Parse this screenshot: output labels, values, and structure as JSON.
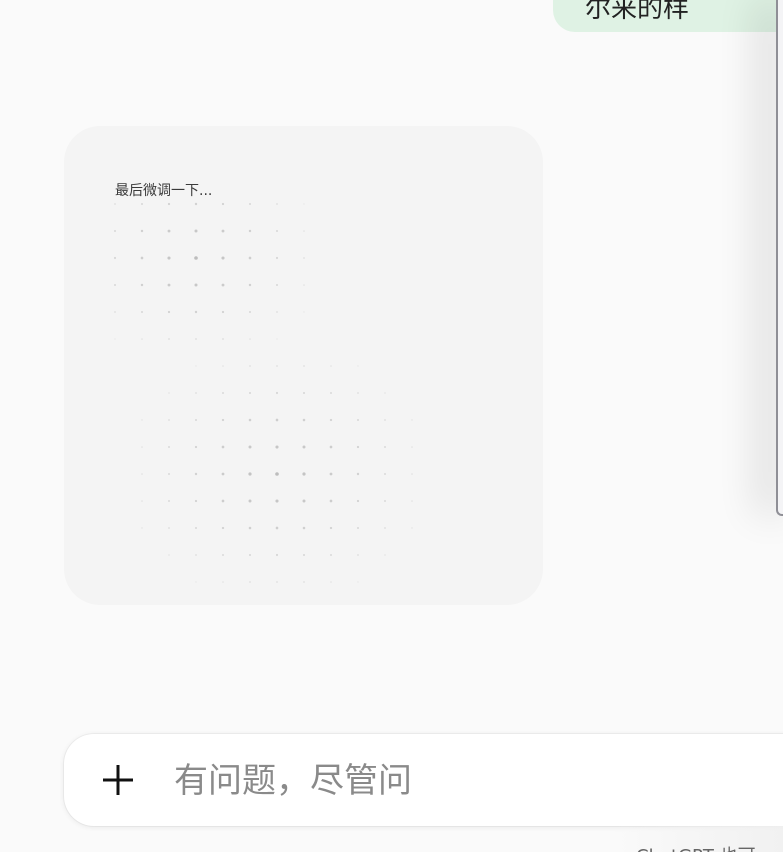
{
  "chat": {
    "user_message": "尔来的样",
    "generation_status": "最后微调一下..."
  },
  "composer": {
    "add_label": "+",
    "placeholder": "有问题，尽管问"
  },
  "footer": {
    "note": "ChatGPT 也可"
  },
  "colors": {
    "page_bg": "#fafafa",
    "user_bubble_bg": "#dff2e4",
    "card_bg": "#f4f4f4",
    "composer_bg": "#ffffff",
    "dot_color": "#bdbdbd"
  },
  "icons": {
    "add": "plus-icon",
    "loading": "dot-matrix-loading-icon"
  }
}
